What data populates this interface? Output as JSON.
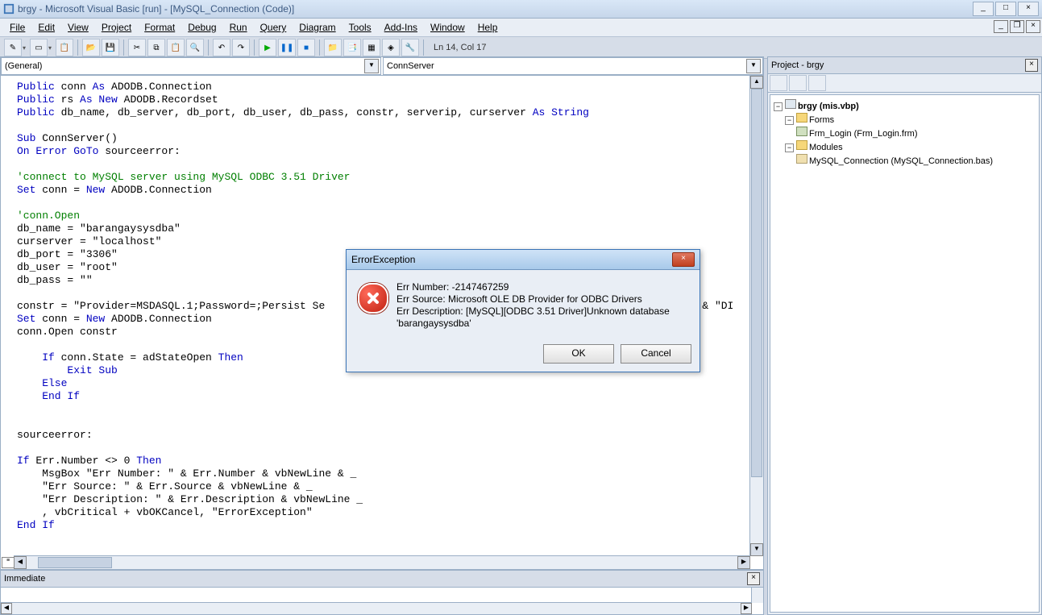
{
  "window": {
    "title": "brgy - Microsoft Visual Basic [run] - [MySQL_Connection (Code)]"
  },
  "menu": [
    "File",
    "Edit",
    "View",
    "Project",
    "Format",
    "Debug",
    "Run",
    "Query",
    "Diagram",
    "Tools",
    "Add-Ins",
    "Window",
    "Help"
  ],
  "toolbar_status": "Ln 14, Col 17",
  "dropdowns": {
    "left": "(General)",
    "right": "ConnServer"
  },
  "code": {
    "l1a": "Public",
    "l1b": " conn ",
    "l1c": "As",
    "l1d": " ADODB.Connection",
    "l2a": "Public",
    "l2b": " rs ",
    "l2c": "As New",
    "l2d": " ADODB.Recordset",
    "l3a": "Public",
    "l3b": " db_name, db_server, db_port, db_user, db_pass, constr, serverip, curserver ",
    "l3c": "As String",
    "l4": "",
    "l5a": "Sub",
    "l5b": " ConnServer()",
    "l6a": "On Error GoTo",
    "l6b": " sourceerror:",
    "l7": "",
    "l8": "'connect to MySQL server using MySQL ODBC 3.51 Driver",
    "l9a": "Set",
    "l9b": " conn = ",
    "l9c": "New",
    "l9d": " ADODB.Connection",
    "l10": "",
    "l11": "'conn.Open",
    "l12": "db_name = \"barangaysysdba\"",
    "l13": "curserver = \"localhost\"",
    "l14": "db_port = \"3306\"",
    "l15": "db_user = \"root\"",
    "l16": "db_pass = \"\"",
    "l17": "",
    "l18": "constr = \"Provider=MSDASQL.1;Password=;Persist Se                                                         4) & \"DI",
    "l19a": "Set",
    "l19b": " conn = ",
    "l19c": "New",
    "l19d": " ADODB.Connection",
    "l20": "conn.Open constr",
    "l21": "",
    "l22a": "    If",
    "l22b": " conn.State = adStateOpen ",
    "l22c": "Then",
    "l23a": "        Exit Sub",
    "l24a": "    Else",
    "l25a": "    End If",
    "l26": "",
    "l27": "",
    "l28": "sourceerror:",
    "l29": "",
    "l30a": "If",
    "l30b": " Err.Number <> 0 ",
    "l30c": "Then",
    "l31": "    MsgBox \"Err Number: \" & Err.Number & vbNewLine & _",
    "l32": "    \"Err Source: \" & Err.Source & vbNewLine & _",
    "l33": "    \"Err Description: \" & Err.Description & vbNewLine _",
    "l34": "    , vbCritical + vbOKCancel, \"ErrorException\"",
    "l35a": "End If"
  },
  "immediate_title": "Immediate",
  "project_panel": {
    "title": "Project - brgy",
    "root": "brgy (mis.vbp)",
    "forms_folder": "Forms",
    "form1": "Frm_Login (Frm_Login.frm)",
    "modules_folder": "Modules",
    "module1": "MySQL_Connection (MySQL_Connection.bas)"
  },
  "modal": {
    "title": "ErrorException",
    "line1": "Err Number: -2147467259",
    "line2": "Err Source: Microsoft OLE DB Provider for ODBC Drivers",
    "line3": "Err Description: [MySQL][ODBC 3.51 Driver]Unknown database",
    "line4": "'barangaysysdba'",
    "ok": "OK",
    "cancel": "Cancel"
  }
}
